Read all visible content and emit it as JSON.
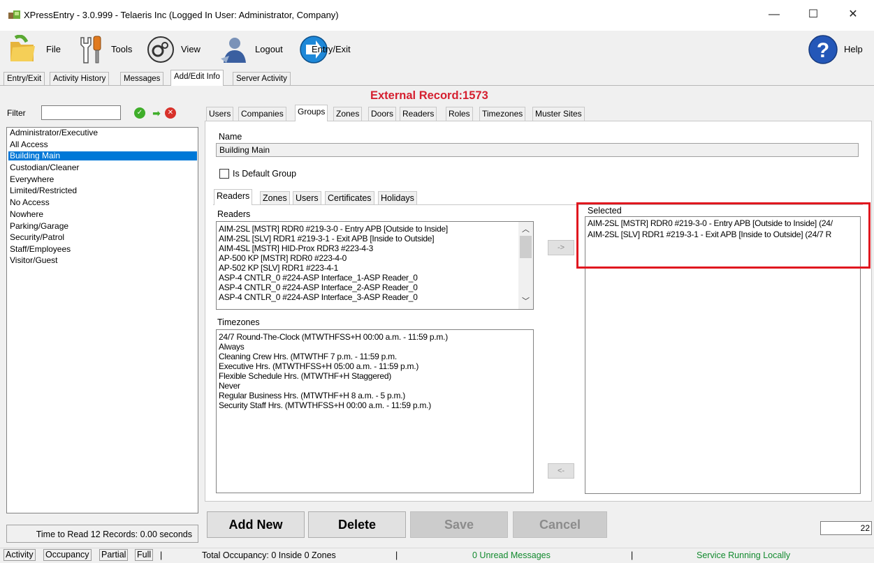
{
  "window": {
    "title": "XPressEntry - 3.0.999 - Telaeris Inc (Logged In User: Administrator, Company)",
    "minimize": "—",
    "maximize": "☐",
    "close": "✕"
  },
  "toolbar": {
    "file": "File",
    "tools": "Tools",
    "view": "View",
    "logout": "Logout",
    "entry_exit": "Entry/Exit",
    "help": "Help"
  },
  "top_tabs": [
    "Entry/Exit",
    "Activity History",
    "Messages",
    "Add/Edit Info",
    "Server Activity"
  ],
  "record_header": "External Record:1573",
  "filter": {
    "label": "Filter",
    "value": "",
    "ok_icon": "check-icon",
    "go_icon": "arrow-right-icon",
    "clear_icon": "x-icon"
  },
  "groups": [
    "Administrator/Executive",
    "All Access",
    "Building Main",
    "Custodian/Cleaner",
    "Everywhere",
    "Limited/Restricted",
    "No Access",
    "Nowhere",
    "Parking/Garage",
    "Security/Patrol",
    "Staff/Employees",
    "Visitor/Guest"
  ],
  "selected_group": "Building Main",
  "time_to_read": "Time to Read 12 Records: 0.00 seconds",
  "sub_tabs": [
    "Users",
    "Companies",
    "Groups",
    "Zones",
    "Doors",
    "Readers",
    "Roles",
    "Timezones",
    "Muster Sites"
  ],
  "form": {
    "name_label": "Name",
    "name_value": "Building Main",
    "default_label": "Is Default Group",
    "default_checked": false
  },
  "inner_tabs": [
    "Readers",
    "Zones",
    "Users",
    "Certificates",
    "Holidays"
  ],
  "readers": {
    "label": "Readers",
    "items": [
      "AIM-2SL [MSTR] RDR0 #219-3-0 - Entry APB [Outside to Inside]",
      "AIM-2SL [SLV] RDR1 #219-3-1 - Exit APB [Inside to Outside]",
      "AIM-4SL [MSTR] HID-Prox RDR3 #223-4-3",
      "AP-500 KP [MSTR] RDR0 #223-4-0",
      "AP-502 KP [SLV] RDR1 #223-4-1",
      "ASP-4 CNTLR_0 #224-ASP Interface_1-ASP Reader_0",
      "ASP-4 CNTLR_0 #224-ASP Interface_2-ASP Reader_0",
      "ASP-4 CNTLR_0 #224-ASP Interface_3-ASP Reader_0"
    ]
  },
  "timezones": {
    "label": "Timezones",
    "items": [
      "24/7 Round-The-Clock (MTWTHFSS+H 00:00 a.m. - 11:59 p.m.)",
      "Always",
      "Cleaning Crew Hrs. (MTWTHF 7 p.m. - 11:59 p.m.",
      "Executive Hrs. (MTWTHFSS+H 05:00 a.m. - 11:59 p.m.)",
      "Flexible Schedule Hrs. (MTWTHF+H Staggered)",
      "Never",
      "Regular Business Hrs. (MTWTHF+H 8 a.m. - 5 p.m.)",
      "Security Staff Hrs. (MTWTHFSS+H 00:00 a.m. - 11:59 p.m.)"
    ]
  },
  "selected": {
    "label": "Selected",
    "items": [
      "AIM-2SL [MSTR] RDR0 #219-3-0 - Entry APB [Outside to Inside] (24/",
      "AIM-2SL [SLV] RDR1 #219-3-1 - Exit APB [Inside to Outside] (24/7 R"
    ]
  },
  "move_buttons": {
    "add": "->",
    "remove": "<-"
  },
  "actions": {
    "add_new": "Add New",
    "delete": "Delete",
    "save": "Save",
    "cancel": "Cancel"
  },
  "record_count": "22",
  "status_bar": {
    "buttons": [
      "Activity",
      "Occupancy",
      "Partial",
      "Full"
    ],
    "separator": "|",
    "occupancy": "Total Occupancy: 0 Inside 0 Zones",
    "messages": "0 Unread Messages",
    "service": "Service Running Locally"
  },
  "colors": {
    "selection": "#0078d7",
    "record_header": "#d52030",
    "highlight_box": "#e0171f",
    "status_green": "#128a2e"
  }
}
